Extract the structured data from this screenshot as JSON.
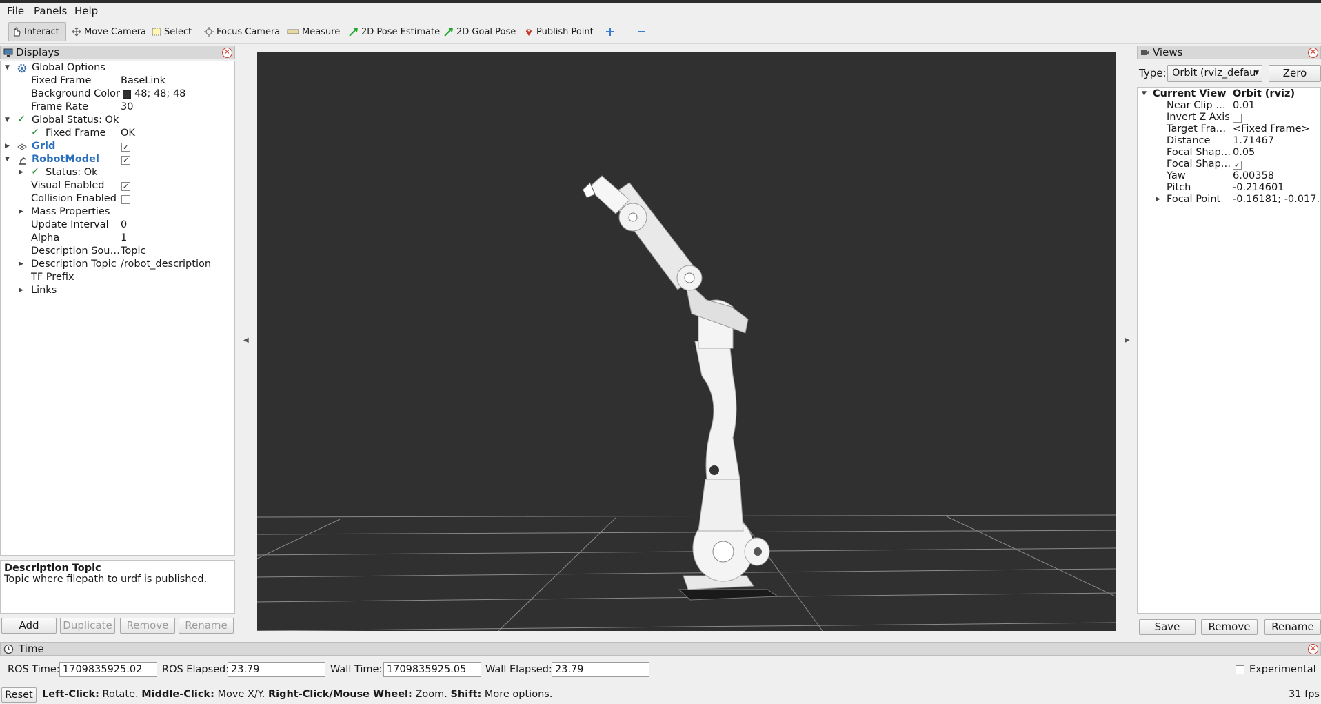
{
  "menu": [
    "File",
    "Panels",
    "Help"
  ],
  "toolbar": {
    "tools": [
      {
        "label": "Interact",
        "icon": "hand-cursor-icon"
      },
      {
        "label": "Move Camera",
        "icon": "move-camera-icon"
      },
      {
        "label": "Select",
        "icon": "select-rect-icon"
      },
      {
        "label": "Focus Camera",
        "icon": "focus-camera-icon"
      },
      {
        "label": "Measure",
        "icon": "ruler-icon"
      },
      {
        "label": "2D Pose Estimate",
        "icon": "green-arrow-icon"
      },
      {
        "label": "2D Goal Pose",
        "icon": "green-arrow-icon"
      },
      {
        "label": "Publish Point",
        "icon": "map-pin-icon"
      }
    ],
    "active": "Interact",
    "colors": {
      "pose": "#1faa2a",
      "pin": "#c0392b",
      "plus": "#3a7bd5"
    }
  },
  "displays": {
    "title": "Displays",
    "rows": [
      {
        "label": "Global Options",
        "value": ""
      },
      {
        "label": "Fixed Frame",
        "value": "BaseLink"
      },
      {
        "label": "Background Color",
        "value": "48; 48; 48"
      },
      {
        "label": "Frame Rate",
        "value": "30"
      },
      {
        "label": "Global Status: Ok",
        "value": ""
      },
      {
        "label": "Fixed Frame",
        "value": "OK"
      },
      {
        "label": "Grid",
        "value": ""
      },
      {
        "label": "RobotModel",
        "value": ""
      },
      {
        "label": "Status: Ok",
        "value": ""
      },
      {
        "label": "Visual Enabled",
        "value": ""
      },
      {
        "label": "Collision Enabled",
        "value": ""
      },
      {
        "label": "Mass Properties",
        "value": ""
      },
      {
        "label": "Update Interval",
        "value": "0"
      },
      {
        "label": "Alpha",
        "value": "1"
      },
      {
        "label": "Description Sou…",
        "value": "Topic"
      },
      {
        "label": "Description Topic",
        "value": "/robot_description"
      },
      {
        "label": "TF Prefix",
        "value": ""
      },
      {
        "label": "Links",
        "value": ""
      }
    ],
    "desc_title": "Description Topic",
    "desc_text": "Topic where filepath to urdf is published.",
    "buttons": [
      "Add",
      "Duplicate",
      "Remove",
      "Rename"
    ]
  },
  "views": {
    "title": "Views",
    "type_label": "Type:",
    "type_value": "Orbit (rviz_defau",
    "zero": "Zero",
    "rows": [
      {
        "label": "Current View",
        "value": "Orbit (rviz)"
      },
      {
        "label": "Near Clip …",
        "value": "0.01"
      },
      {
        "label": "Invert Z Axis",
        "value": ""
      },
      {
        "label": "Target Fra…",
        "value": "<Fixed Frame>"
      },
      {
        "label": "Distance",
        "value": "1.71467"
      },
      {
        "label": "Focal Shap…",
        "value": "0.05"
      },
      {
        "label": "Focal Shap…",
        "value": ""
      },
      {
        "label": "Yaw",
        "value": "6.00358"
      },
      {
        "label": "Pitch",
        "value": "-0.214601"
      },
      {
        "label": "Focal Point",
        "value": "-0.16181; -0.017…"
      }
    ],
    "buttons": [
      "Save",
      "Remove",
      "Rename"
    ]
  },
  "time": {
    "title": "Time",
    "ros_time_label": "ROS Time:",
    "ros_time": "1709835925.02",
    "ros_elapsed_label": "ROS Elapsed:",
    "ros_elapsed": "23.79",
    "wall_time_label": "Wall Time:",
    "wall_time": "1709835925.05",
    "wall_elapsed_label": "Wall Elapsed:",
    "wall_elapsed": "23.79",
    "experimental": "Experimental"
  },
  "status": {
    "reset": "Reset",
    "hint": [
      {
        "b": "Left-Click:",
        "t": " Rotate. "
      },
      {
        "b": "Middle-Click:",
        "t": " Move X/Y. "
      },
      {
        "b": "Right-Click/Mouse Wheel:",
        "t": " Zoom. "
      },
      {
        "b": "Shift:",
        "t": " More options."
      }
    ],
    "fps": "31 fps"
  }
}
